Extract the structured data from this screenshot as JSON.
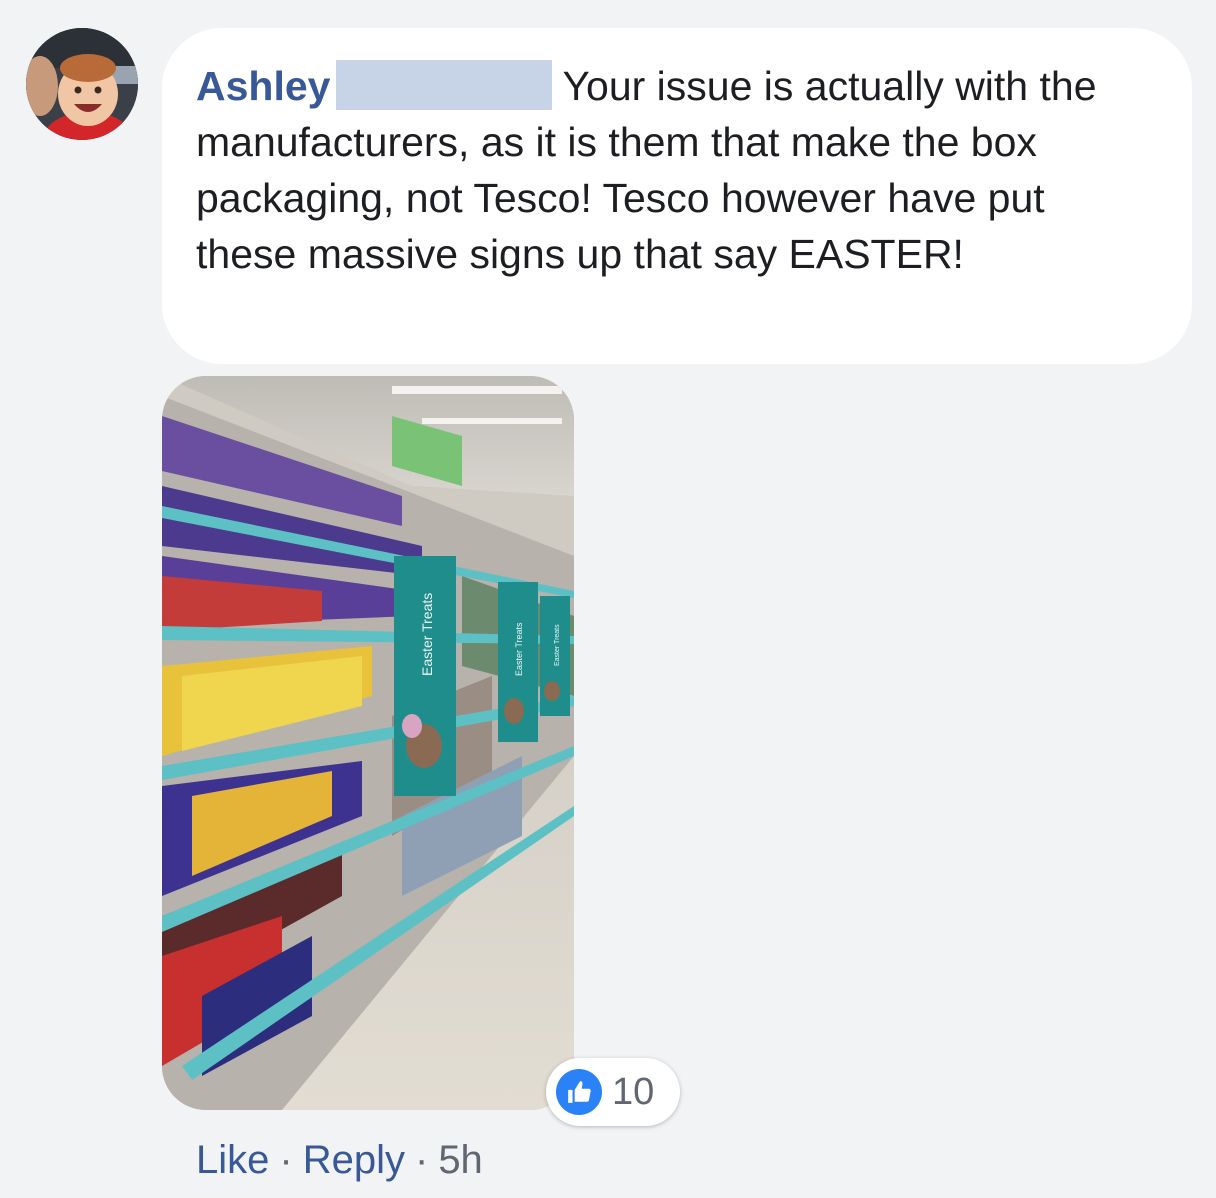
{
  "comment": {
    "author": "Ashley",
    "text": "Your issue is actually with the manufacturers, as it is them that make the box packaging, not Tesco! Tesco however have put these massive signs up that say EASTER!"
  },
  "photo": {
    "signs": [
      "Easter Treats",
      "Easter Treats",
      "Easter Treats"
    ]
  },
  "reactions": {
    "icon": "thumbs-up-icon",
    "count": "10"
  },
  "actions": {
    "like": "Like",
    "reply": "Reply",
    "separator": "·",
    "time": "5h"
  },
  "colors": {
    "background": "#f2f3f5",
    "bubble": "#ffffff",
    "link": "#385898",
    "meta": "#606770",
    "like_badge": "#2b82f6",
    "sign": "#1f8d8b"
  }
}
